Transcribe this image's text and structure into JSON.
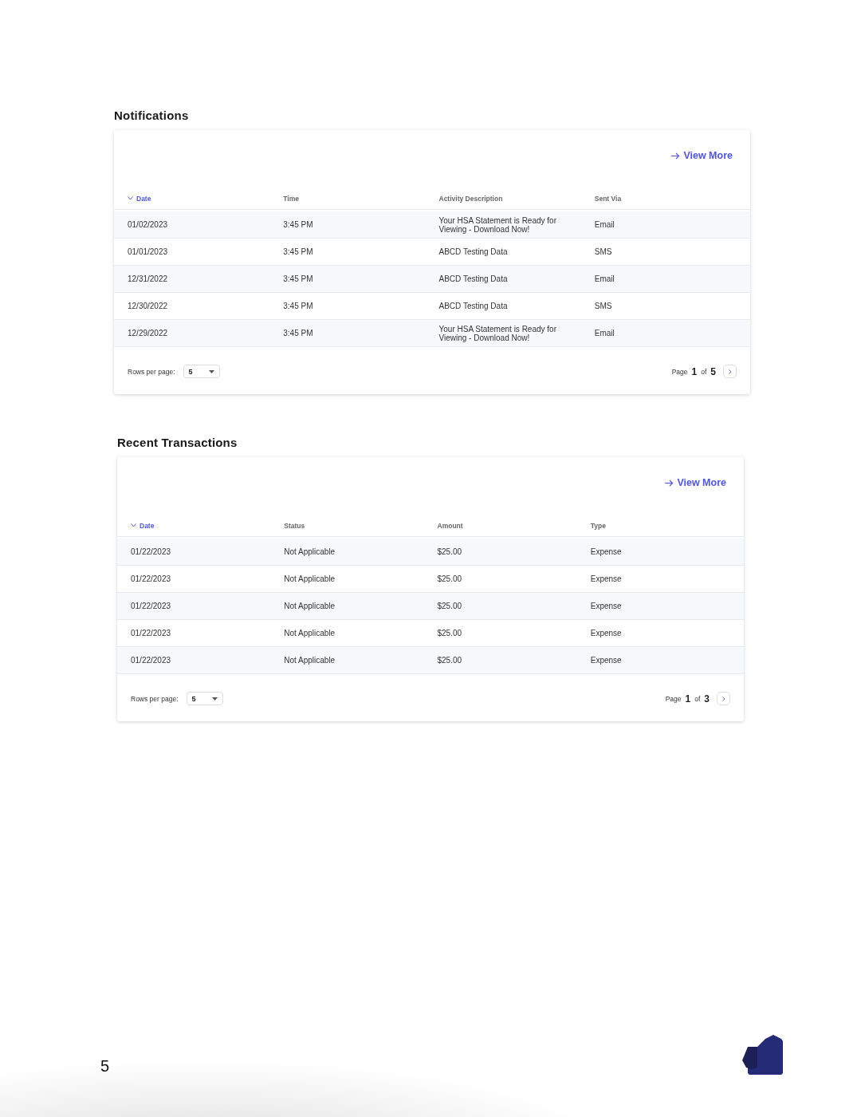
{
  "sections": [
    {
      "title": "Notifications",
      "view_more": "View More",
      "columns": [
        {
          "label": "Date",
          "sorted": true
        },
        {
          "label": "Time",
          "sorted": false
        },
        {
          "label": "Activity Description",
          "sorted": false
        },
        {
          "label": "Sent Via",
          "sorted": false
        }
      ],
      "rows": [
        [
          "01/02/2023",
          "3:45 PM",
          "Your HSA Statement is Ready for Viewing - Download Now!",
          "Email"
        ],
        [
          "01/01/2023",
          "3:45 PM",
          "ABCD Testing Data",
          "SMS"
        ],
        [
          "12/31/2022",
          "3:45 PM",
          "ABCD Testing Data",
          "Email"
        ],
        [
          "12/30/2022",
          "3:45 PM",
          "ABCD Testing Data",
          "SMS"
        ],
        [
          "12/29/2022",
          "3:45 PM",
          "Your HSA Statement is Ready for Viewing - Download Now!",
          "Email"
        ]
      ],
      "rows_per_page_label": "Rows per page:",
      "rows_per_page": "5",
      "page_label": "Page",
      "page": "1",
      "of_label": "of",
      "page_total": "5"
    },
    {
      "title": "Recent Transactions",
      "view_more": "View More",
      "columns": [
        {
          "label": "Date",
          "sorted": true
        },
        {
          "label": "Status",
          "sorted": false
        },
        {
          "label": "Amount",
          "sorted": false
        },
        {
          "label": "Type",
          "sorted": false
        }
      ],
      "rows": [
        [
          "01/22/2023",
          "Not Applicable",
          "$25.00",
          "Expense"
        ],
        [
          "01/22/2023",
          "Not Applicable",
          "$25.00",
          "Expense"
        ],
        [
          "01/22/2023",
          "Not Applicable",
          "$25.00",
          "Expense"
        ],
        [
          "01/22/2023",
          "Not Applicable",
          "$25.00",
          "Expense"
        ],
        [
          "01/22/2023",
          "Not Applicable",
          "$25.00",
          "Expense"
        ]
      ],
      "rows_per_page_label": "Rows per page:",
      "rows_per_page": "5",
      "page_label": "Page",
      "page": "1",
      "of_label": "of",
      "page_total": "3"
    }
  ],
  "page_number": "5"
}
